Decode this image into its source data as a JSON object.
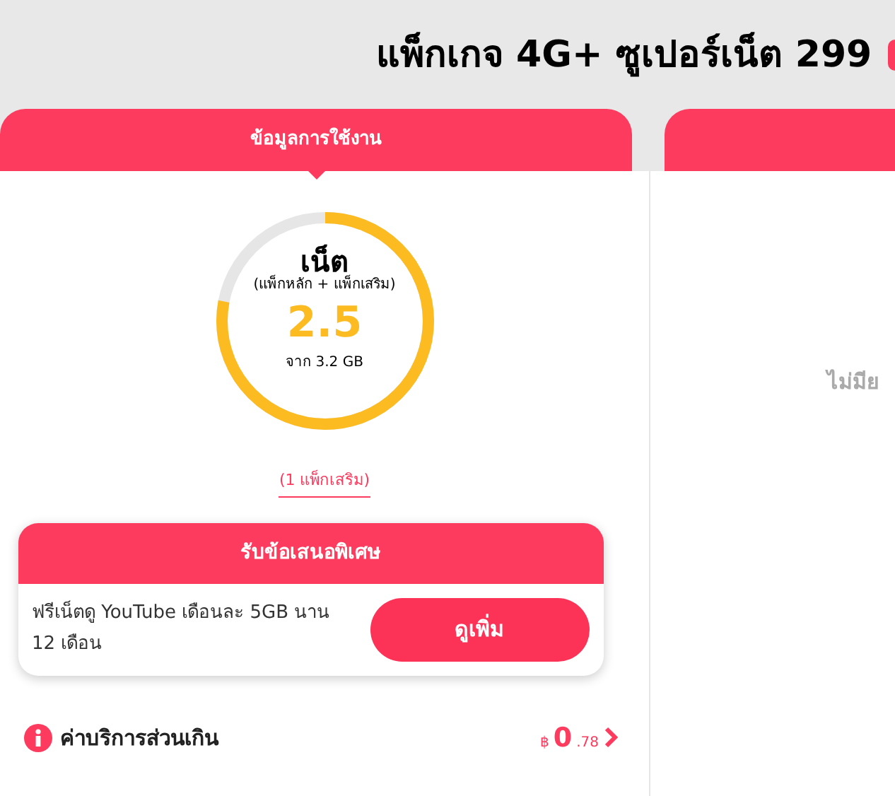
{
  "title": "แพ็กเกจ 4G+ ซูเปอร์เน็ต 299",
  "tabs": [
    {
      "label": "ข้อมูลการใช้งาน",
      "selected": true
    },
    {
      "selected": false
    }
  ],
  "usage": {
    "name": "เน็ต",
    "subtitle": "(แพ็กหลัก + แพ็กเสริม)",
    "remaining": "2.5",
    "total": "จาก 3.2 GB",
    "level": 0.78
  },
  "addon_link": "(1 แพ็กเสริม)",
  "offer": {
    "title": "รับข้อเสนอพิเศษ",
    "text": "ฟรีเน็ตดู YouTube เดือนละ 5GB นาน 12 เดือน",
    "button": "ดูเพิ่ม"
  },
  "overage": {
    "label": "ค่าบริการส่วนเกิน",
    "currency": "฿",
    "amount": "0",
    "decimals": ".78"
  },
  "right_panel": {
    "message": "ไม่มีย"
  }
}
